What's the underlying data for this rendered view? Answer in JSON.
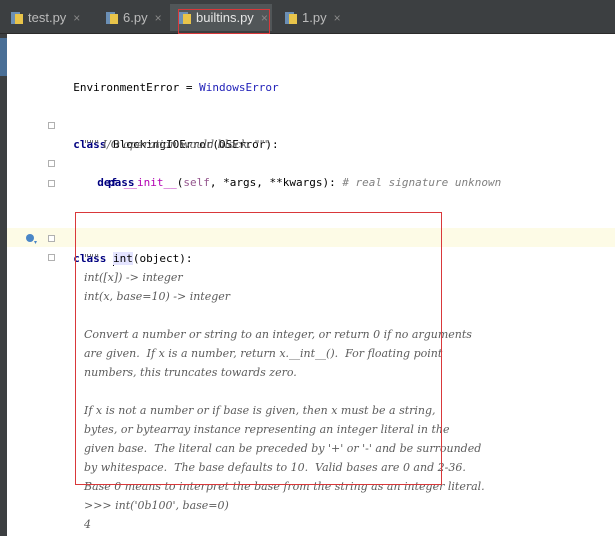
{
  "tabs": [
    {
      "label": "test.py",
      "active": false
    },
    {
      "label": "6.py",
      "active": false
    },
    {
      "label": "builtins.py",
      "active": true
    },
    {
      "label": "1.py",
      "active": false
    }
  ],
  "close_glyph": "×",
  "code": {
    "l1_left": "EnvironmentError",
    "l1_eq": " = ",
    "l1_right": "WindowsError",
    "l2_kw": "class",
    "l2_name": " BlockingIOError(OSError):",
    "l3_doc": "\"\"\" I/O operation would block. \"\"\"",
    "l4_kw": "def",
    "l4_name": "__init__",
    "l4_open": "(",
    "l4_self": "self",
    "l4_rest": ", *args, **kwargs): ",
    "l4_cmt": "# real signature unknown",
    "l5_kw": "pass",
    "l6_kw": "class",
    "l6_pre": " ",
    "l6_word": "int",
    "l6_rest": "(object):",
    "d1": "\"\"\"",
    "d2": "int([x]) -> integer",
    "d3": "int(x, base=10) -> integer",
    "d4": "Convert a number or string to an integer, or return 0 if no arguments",
    "d5": "are given.  If x is a number, return x.__int__().  For floating point",
    "d6": "numbers, this truncates towards zero.",
    "d7": "If x is not a number or if base is given, then x must be a string,",
    "d8": "bytes, or bytearray instance representing an integer literal in the",
    "d9": "given base.  The literal can be preceded by '+' or '-' and be surrounded",
    "d10": "by whitespace.  The base defaults to 10.  Valid bases are 0 and 2-36.",
    "d11": "Base 0 means to interpret the base from the string as an integer literal.",
    "d12": ">>> int('0b100', base=0)",
    "d13": "4"
  },
  "colors": {
    "annotation_box": "#d9383a",
    "keyword": "#000080",
    "docstring": "#5c5c5c"
  }
}
